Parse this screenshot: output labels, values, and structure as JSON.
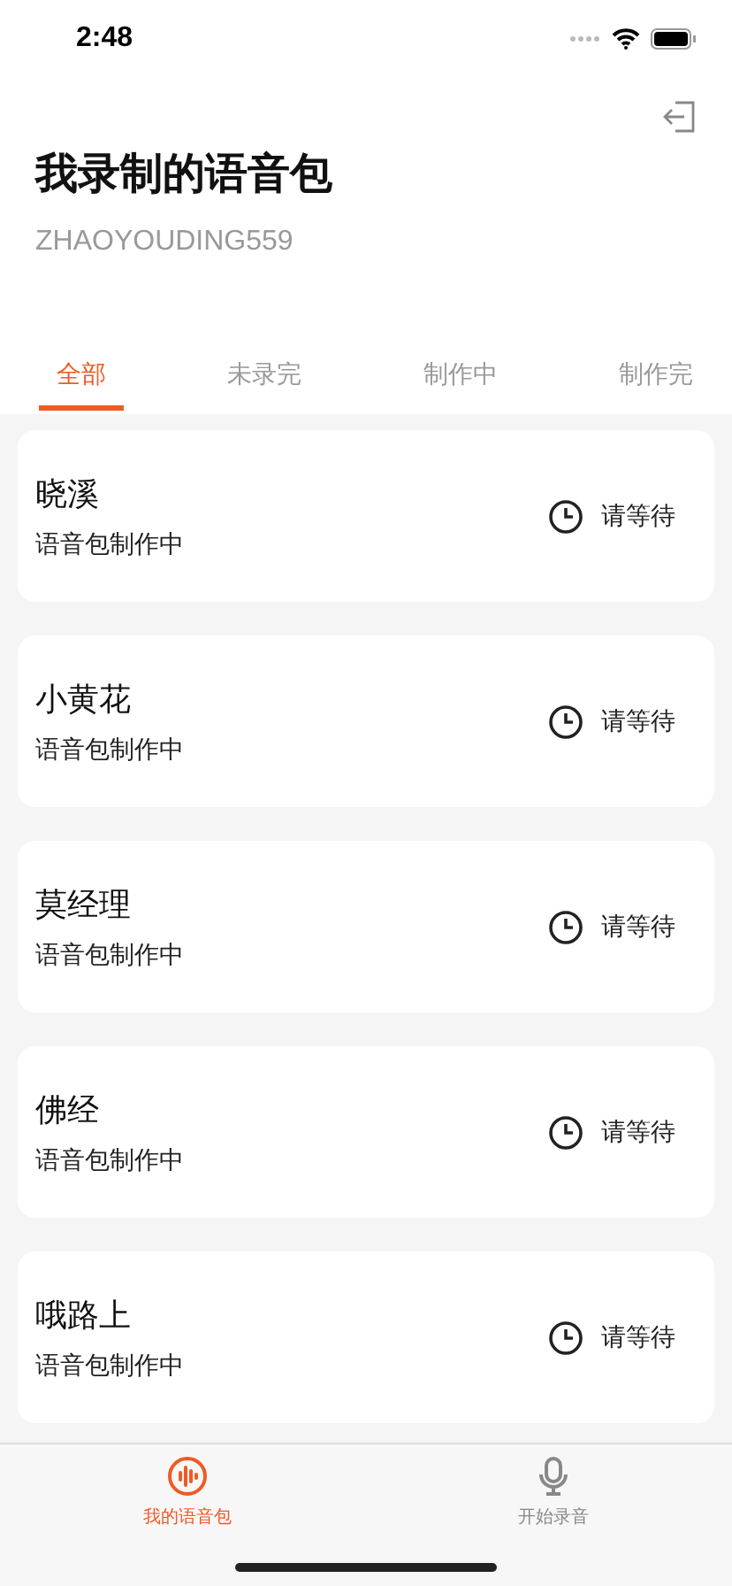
{
  "status_bar": {
    "time": "2:48"
  },
  "header": {
    "title": "我录制的语音包",
    "user_id": "ZHAOYOUDING559"
  },
  "tabs": [
    {
      "label": "全部",
      "selected": true
    },
    {
      "label": "未录完",
      "selected": false
    },
    {
      "label": "制作中",
      "selected": false
    },
    {
      "label": "制作完",
      "selected": false
    }
  ],
  "packs": [
    {
      "name": "晓溪",
      "status": "语音包制作中",
      "action": "请等待"
    },
    {
      "name": "小黄花",
      "status": "语音包制作中",
      "action": "请等待"
    },
    {
      "name": "莫经理",
      "status": "语音包制作中",
      "action": "请等待"
    },
    {
      "name": "佛经",
      "status": "语音包制作中",
      "action": "请等待"
    },
    {
      "name": "哦路上",
      "status": "语音包制作中",
      "action": "请等待"
    }
  ],
  "bottom_nav": [
    {
      "label": "我的语音包",
      "selected": true
    },
    {
      "label": "开始录音",
      "selected": false
    }
  ]
}
